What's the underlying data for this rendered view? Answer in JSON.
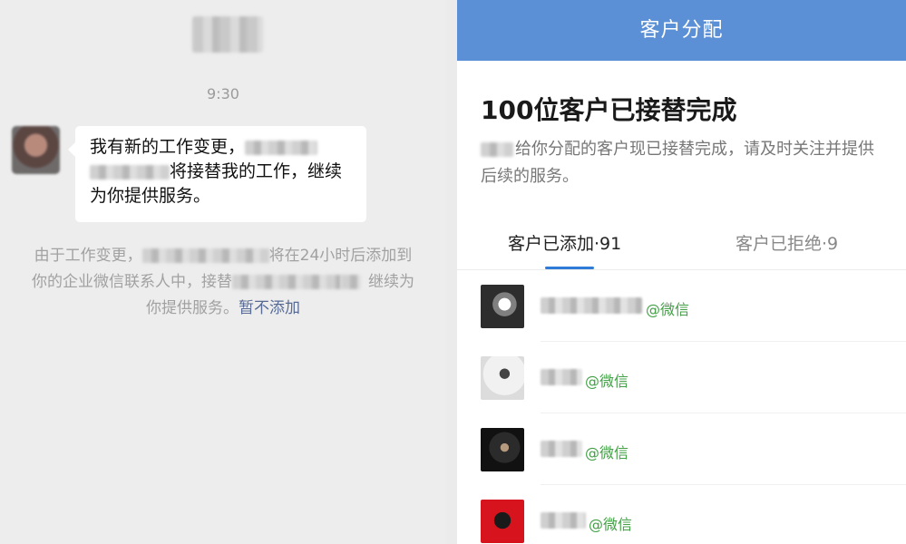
{
  "chat": {
    "title": "",
    "time": "9:30",
    "message_part1": "我有新的工作变更，",
    "message_part2": "将接替我的工作，继续为你提供服务。",
    "notice_part1": "由于工作变更，",
    "notice_part2": "将在24小时后添加到你的企业微信联系人中，接替",
    "notice_part3": "继续为你提供服务。",
    "notice_link": "暂不添加"
  },
  "panel": {
    "header_title": "客户分配",
    "headline": "100位客户已接替完成",
    "description": "给你分配的客户现已接替完成，请及时关注并提供后续的服务。",
    "tabs": {
      "added": "客户已添加·91",
      "rejected": "客户已拒绝·9"
    },
    "customers": [
      {
        "source": "@微信"
      },
      {
        "source": "@微信"
      },
      {
        "source": "@微信"
      },
      {
        "source": "@微信"
      }
    ]
  },
  "colors": {
    "header": "#5b8fd6",
    "accent": "#2f7bd8",
    "wechat_green": "#43a047",
    "link": "#576b95"
  }
}
